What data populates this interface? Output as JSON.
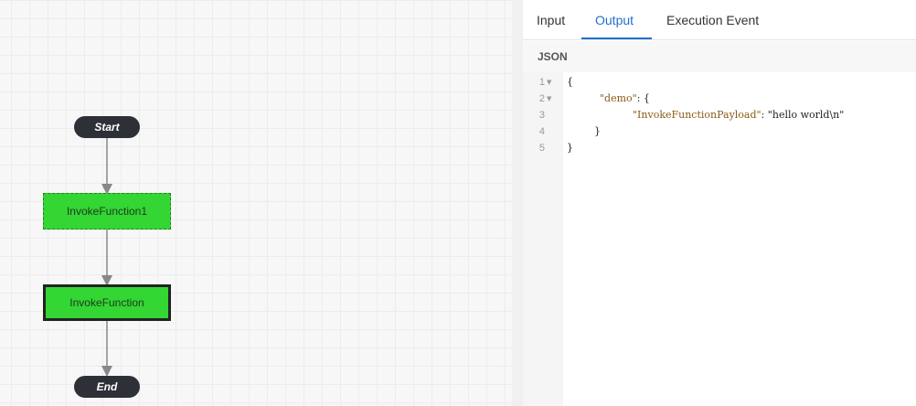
{
  "flow": {
    "start_label": "Start",
    "end_label": "End",
    "nodes": [
      {
        "label": "InvokeFunction1",
        "state": "dashed"
      },
      {
        "label": "InvokeFunction",
        "state": "selected"
      }
    ],
    "colors": {
      "task_fill": "#33d633",
      "terminal_fill": "#2e3038",
      "edge": "#888888"
    }
  },
  "panel": {
    "tabs": [
      {
        "label": "Input",
        "active": false
      },
      {
        "label": "Output",
        "active": true
      },
      {
        "label": "Execution Event",
        "active": false
      }
    ],
    "format_label": "JSON",
    "code_lines": [
      {
        "number": "1",
        "foldable": true,
        "text": "{"
      },
      {
        "number": "2",
        "foldable": true,
        "key": "\"demo\"",
        "rest": ": {"
      },
      {
        "number": "3",
        "foldable": false,
        "key": "\"InvokeFunctionPayload\"",
        "rest": ": \"hello world\\n\""
      },
      {
        "number": "4",
        "foldable": false,
        "text": "}"
      },
      {
        "number": "5",
        "foldable": false,
        "text": "}"
      }
    ],
    "accent_color": "#1f6fd1"
  }
}
